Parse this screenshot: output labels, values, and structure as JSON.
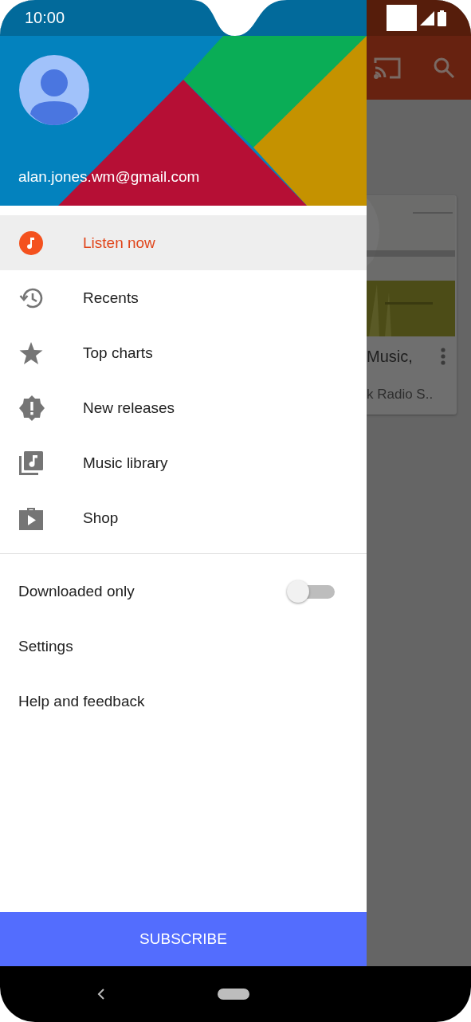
{
  "status_bar": {
    "time": "10:00"
  },
  "account": {
    "email": "alan.jones.wm@gmail.com"
  },
  "nav_items": [
    {
      "label": "Listen now",
      "kind": "listen",
      "selected": true
    },
    {
      "label": "Recents",
      "kind": "recents",
      "selected": false
    },
    {
      "label": "Top charts",
      "kind": "star",
      "selected": false
    },
    {
      "label": "New releases",
      "kind": "badge",
      "selected": false
    },
    {
      "label": "Music library",
      "kind": "library",
      "selected": false
    },
    {
      "label": "Shop",
      "kind": "shop",
      "selected": false
    }
  ],
  "settings_items": [
    {
      "kind": "toggle",
      "label": "Downloaded only",
      "on": false
    },
    {
      "kind": "link",
      "label": "Settings"
    },
    {
      "kind": "link",
      "label": "Help and feedback"
    }
  ],
  "subscribe_button": "SUBSCRIBE",
  "background_card": {
    "title": "Music,",
    "subtitle": "k Radio S.."
  }
}
